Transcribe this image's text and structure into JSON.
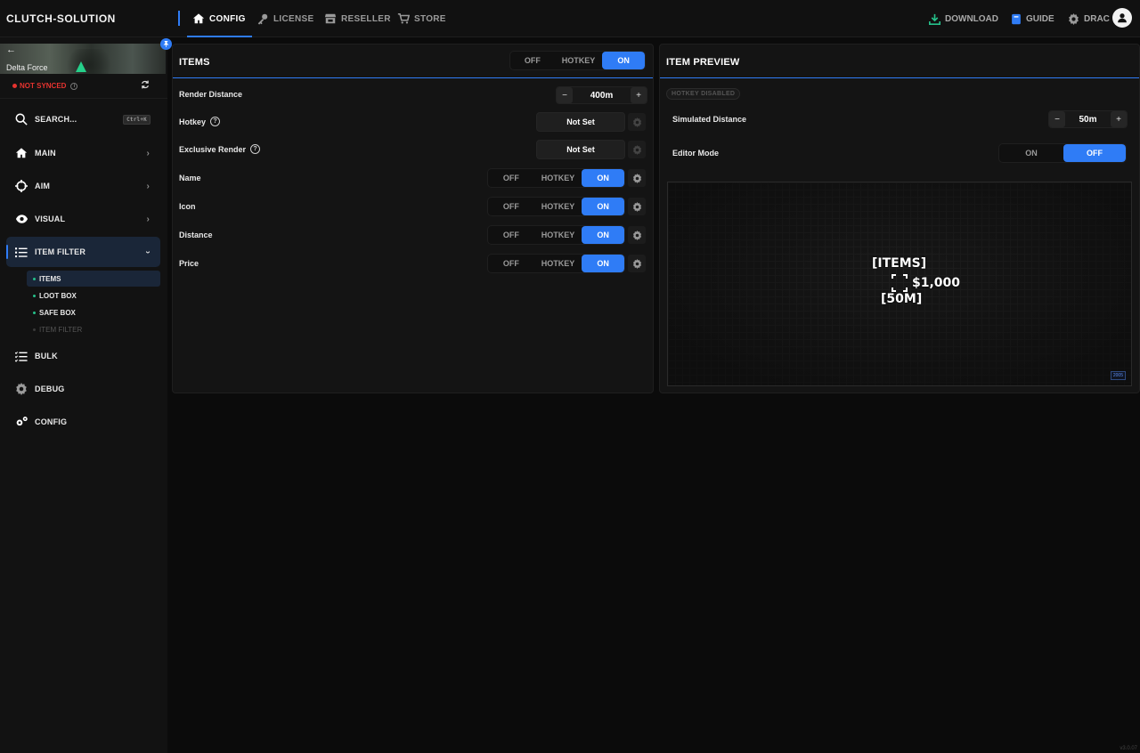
{
  "app": {
    "brand": "CLUTCH-SOLUTION",
    "version": "v3.0.07"
  },
  "colors": {
    "accent": "#2f7cf6",
    "danger": "#e5332f",
    "download": "#25c08a"
  },
  "topnav": {
    "tabs": [
      {
        "label": "CONFIG",
        "icon": "home-icon",
        "active": true
      },
      {
        "label": "LICENSE",
        "icon": "key-icon"
      },
      {
        "label": "RESELLER",
        "icon": "store-icon"
      },
      {
        "label": "STORE",
        "icon": "cart-icon"
      }
    ],
    "download": "DOWNLOAD",
    "guide": "GUIDE",
    "user": "DRAC"
  },
  "sidebar": {
    "game_name": "Delta Force",
    "sync_status": "NOT SYNCED",
    "search_label": "SEARCH...",
    "search_shortcut": "Ctrl+K",
    "items": [
      {
        "label": "MAIN",
        "icon": "home-icon"
      },
      {
        "label": "AIM",
        "icon": "crosshair-icon"
      },
      {
        "label": "VISUAL",
        "icon": "eye-icon"
      },
      {
        "label": "ITEM FILTER",
        "icon": "list-icon",
        "active": true
      },
      {
        "label": "BULK",
        "icon": "checklist-icon"
      },
      {
        "label": "DEBUG",
        "icon": "gear-icon"
      },
      {
        "label": "CONFIG",
        "icon": "gears-icon"
      }
    ],
    "subitems": [
      {
        "label": "ITEMS",
        "active": true
      },
      {
        "label": "LOOT BOX"
      },
      {
        "label": "SAFE BOX"
      },
      {
        "label": "ITEM FILTER",
        "disabled": true
      }
    ]
  },
  "items_panel": {
    "title": "ITEMS",
    "toggle": {
      "off": "OFF",
      "hotkey": "HOTKEY",
      "on": "ON",
      "selected": "ON"
    },
    "render_distance": {
      "label": "Render Distance",
      "value": "400m",
      "minus": "−",
      "plus": "+"
    },
    "hotkey": {
      "label": "Hotkey",
      "help": "?",
      "value": "Not Set"
    },
    "exclusive_render": {
      "label": "Exclusive Render",
      "help": "?",
      "value": "Not Set"
    },
    "rows": [
      {
        "label": "Name",
        "off": "OFF",
        "hotkey": "HOTKEY",
        "on": "ON",
        "selected": "ON"
      },
      {
        "label": "Icon",
        "off": "OFF",
        "hotkey": "HOTKEY",
        "on": "ON",
        "selected": "ON"
      },
      {
        "label": "Distance",
        "off": "OFF",
        "hotkey": "HOTKEY",
        "on": "ON",
        "selected": "ON"
      },
      {
        "label": "Price",
        "off": "OFF",
        "hotkey": "HOTKEY",
        "on": "ON",
        "selected": "ON"
      }
    ]
  },
  "preview_panel": {
    "title": "ITEM PREVIEW",
    "hotkey_tag": "HOTKEY DISABLED",
    "simulated_distance": {
      "label": "Simulated Distance",
      "value": "50m",
      "minus": "−",
      "plus": "+"
    },
    "editor_mode": {
      "label": "Editor Mode",
      "on": "ON",
      "off": "OFF",
      "selected": "OFF"
    },
    "esp": {
      "name": "[ITEMS]",
      "price": "$1,000",
      "distance": "[50M]",
      "badge": "2005"
    }
  }
}
